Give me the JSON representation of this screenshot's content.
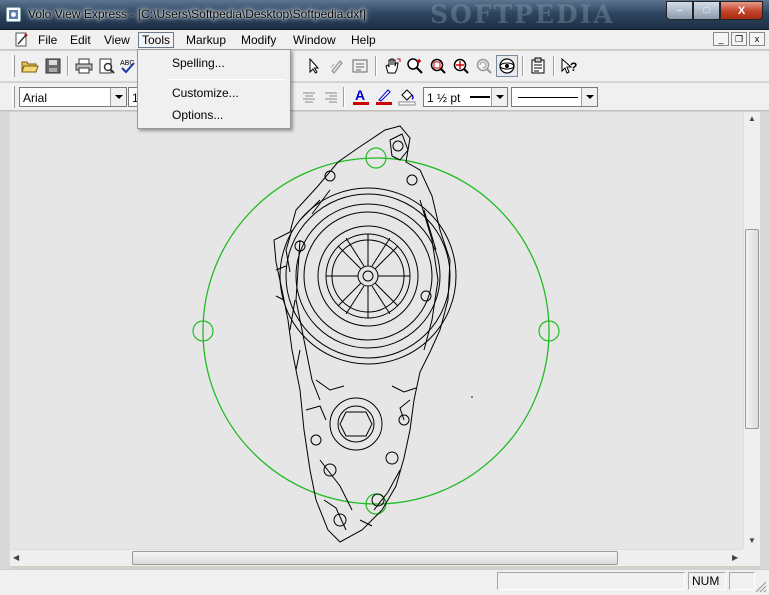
{
  "window": {
    "title": "Volo View Express - [C:\\Users\\Softpedia\\Desktop\\Softpedia.dxf]",
    "watermark": "SOFTPEDIA",
    "caption_minimize": "–",
    "caption_maximize": "□",
    "caption_close": "X"
  },
  "menubar": {
    "items": [
      "File",
      "Edit",
      "View",
      "Tools",
      "Markup",
      "Modify",
      "Window",
      "Help"
    ],
    "active": "Tools",
    "mdi": [
      "_",
      "❐",
      "x"
    ]
  },
  "tools_menu": {
    "items": [
      "Spelling...",
      "Customize...",
      "Options..."
    ]
  },
  "toolbar_format": {
    "font_name": "Arial",
    "font_size": "1",
    "line_weight": "1 ½ pt"
  },
  "toolbar_icons": [
    "open-icon",
    "save-icon",
    "print-icon",
    "print-preview-icon",
    "spell-check-icon",
    "select-arrow-icon",
    "markup-pen-icon",
    "text-box-icon",
    "pan-icon",
    "zoom-realtime-icon",
    "zoom-window-icon",
    "zoom-extents-icon",
    "zoom-previous-icon",
    "orbit-icon",
    "properties-icon",
    "help-icon"
  ],
  "statusbar": {
    "num": "NUM"
  },
  "colors": {
    "titlebar": "#2e4660",
    "canvas": "#e6e6e6",
    "orbit": "#22bb22",
    "markup_red": "#cc0000",
    "markup_blue": "#0000cc"
  }
}
